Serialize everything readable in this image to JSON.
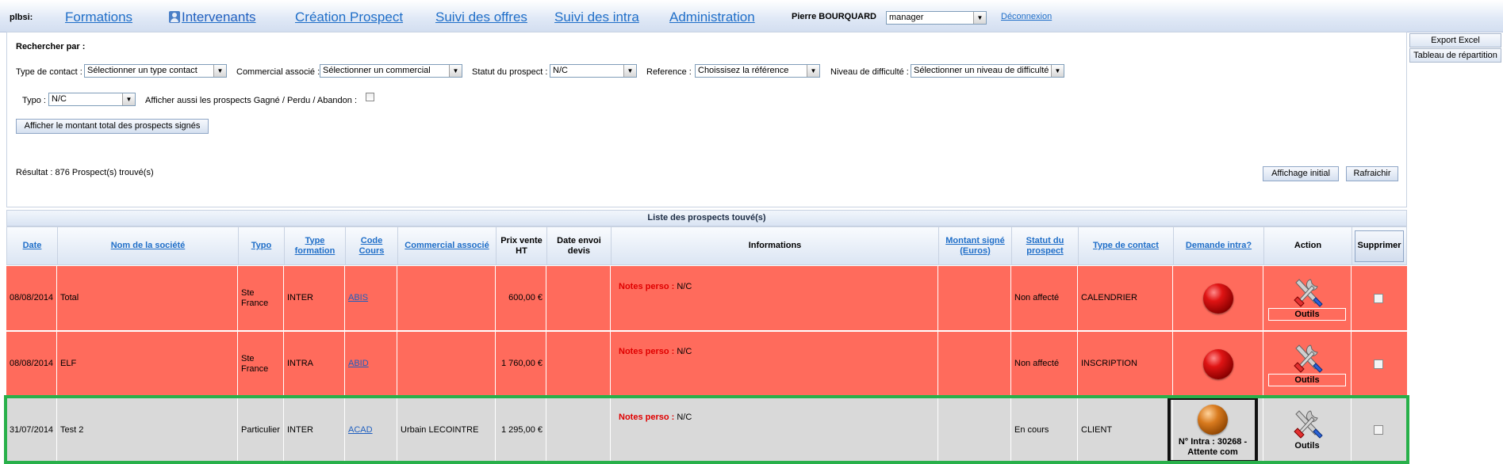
{
  "app": {
    "brand": "plbsi:"
  },
  "nav": {
    "items": [
      "Formations",
      "Intervenants",
      "Création Prospect",
      "Suivi des offres",
      "Suivi des intra",
      "Administration"
    ],
    "user_name": "Pierre BOURQUARD",
    "role_value": "manager",
    "logout": "Déconnexion"
  },
  "side": {
    "export_excel": "Export Excel",
    "repartition": "Tableau de répartition"
  },
  "search": {
    "title": "Rechercher par :",
    "type_contact_label": "Type de contact :",
    "type_contact_value": "Sélectionner un type contact",
    "commercial_label": "Commercial associé :",
    "commercial_value": "Sélectionner un commercial",
    "statut_label": "Statut du prospect :",
    "statut_value": "N/C",
    "reference_label": "Reference :",
    "reference_value": "Choissisez la référence",
    "difficulte_label": "Niveau de difficulté :",
    "difficulte_value": "Sélectionner un niveau de difficulté",
    "typo_label": "Typo :",
    "typo_value": "N/C",
    "show_closed_label": "Afficher aussi les prospects Gagné / Perdu / Abandon :",
    "show_total_button": "Afficher le montant total des prospects signés",
    "result_text": "Résultat : 876 Prospect(s) trouvé(s)",
    "initial_button": "Affichage initial",
    "refresh_button": "Rafraichir"
  },
  "table": {
    "title": "Liste des prospects touvé(s)",
    "columns": {
      "date": "Date",
      "societe": "Nom de la société",
      "typo": "Typo",
      "type_formation": "Type formation",
      "code_cours": "Code Cours",
      "commercial": "Commercial associé",
      "prix": "Prix vente HT",
      "date_envoi": "Date envoi devis",
      "informations": "Informations",
      "montant": "Montant signé (Euros)",
      "statut": "Statut du prospect",
      "type_contact": "Type de contact",
      "demande_intra": "Demande intra?",
      "action": "Action",
      "supprimer": "Supprimer"
    },
    "notes_key": "Notes perso :",
    "tools_label": "Outils",
    "rows": [
      {
        "date": "08/08/2014",
        "societe": "Total",
        "typo": "Ste France",
        "type_formation": "INTER",
        "code": "ABIS",
        "commercial": "",
        "prix": "600,00 €",
        "date_envoi": "",
        "notes": "N/C",
        "montant": "",
        "statut": "Non affecté",
        "type_contact": "CALENDRIER",
        "intra_status": "red",
        "intra_text": "",
        "color": "#ff6b5c"
      },
      {
        "date": "08/08/2014",
        "societe": "ELF",
        "typo": "Ste France",
        "type_formation": "INTRA",
        "code": "ABID",
        "commercial": "",
        "prix": "1 760,00 €",
        "date_envoi": "",
        "notes": "N/C",
        "montant": "",
        "statut": "Non affecté",
        "type_contact": "INSCRIPTION",
        "intra_status": "red",
        "intra_text": "",
        "color": "#ff6b5c"
      },
      {
        "date": "31/07/2014",
        "societe": "Test 2",
        "typo": "Particulier",
        "type_formation": "INTER",
        "code": "ACAD",
        "commercial": "Urbain LECOINTRE",
        "prix": "1 295,00 €",
        "date_envoi": "",
        "notes": "N/C",
        "montant": "",
        "statut": "En cours",
        "type_contact": "CLIENT",
        "intra_status": "orange",
        "intra_text": "N° Intra : 30268 - Attente com",
        "color": "#d9d9d9"
      }
    ]
  },
  "colors": {
    "header_gradient_bottom": "#dbe5f3",
    "link_blue": "#1f6ec8",
    "row_red": "#ff6b5c",
    "row_grey": "#d9d9d9",
    "highlight_green": "#28b04a",
    "notes_red": "#e00000"
  }
}
